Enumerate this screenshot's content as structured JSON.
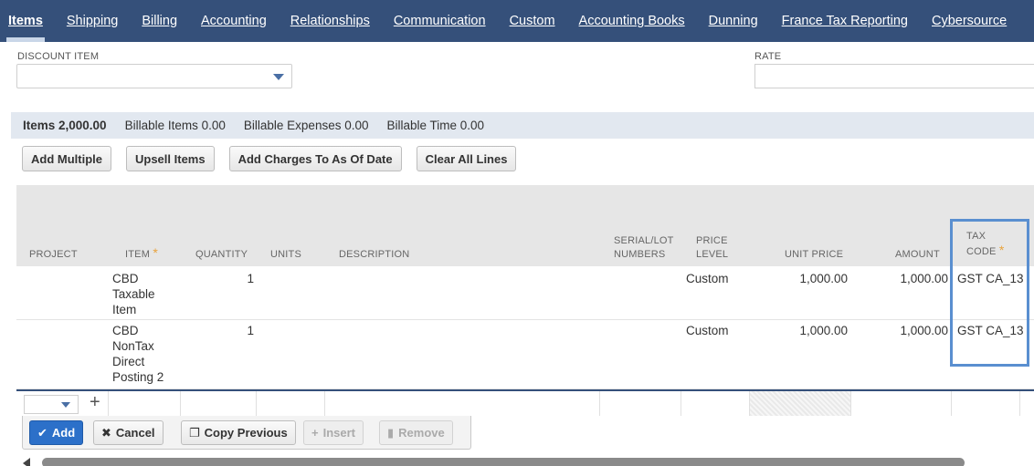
{
  "tabs": [
    {
      "label": "Items",
      "active": true
    },
    {
      "label": "Shipping"
    },
    {
      "label": "Billing"
    },
    {
      "label": "Accounting"
    },
    {
      "label": "Relationships"
    },
    {
      "label": "Communication"
    },
    {
      "label": "Custom"
    },
    {
      "label": "Accounting Books"
    },
    {
      "label": "Dunning"
    },
    {
      "label": "France Tax Reporting"
    },
    {
      "label": "Cybersource"
    }
  ],
  "fields": {
    "discount_label": "DISCOUNT ITEM",
    "discount_value": "",
    "rate_label": "RATE",
    "rate_value": ""
  },
  "subtabs": [
    {
      "label": "Items 2,000.00",
      "active": true
    },
    {
      "label": "Billable Items 0.00"
    },
    {
      "label": "Billable Expenses 0.00"
    },
    {
      "label": "Billable Time 0.00"
    }
  ],
  "buttons": {
    "add_multiple": "Add Multiple",
    "upsell": "Upsell Items",
    "add_charges": "Add Charges To As Of Date",
    "clear_all": "Clear All Lines"
  },
  "columns": {
    "project": "PROJECT",
    "item": "ITEM",
    "quantity": "QUANTITY",
    "units": "UNITS",
    "description": "DESCRIPTION",
    "serial_1": "SERIAL/LOT",
    "serial_2": "NUMBERS",
    "price_1": "PRICE",
    "price_2": "LEVEL",
    "unit_price": "UNIT PRICE",
    "amount": "AMOUNT",
    "tax_1": "TAX",
    "tax_2": "CODE",
    "required_mark": "*"
  },
  "rows": [
    {
      "item_lines": [
        "CBD",
        "Taxable",
        "Item"
      ],
      "quantity": "1",
      "price_level": "Custom",
      "unit_price": "1,000.00",
      "amount": "1,000.00",
      "tax_code": "GST CA_13"
    },
    {
      "item_lines": [
        "CBD",
        "NonTax",
        "Direct",
        "Posting 2"
      ],
      "quantity": "1",
      "price_level": "Custom",
      "unit_price": "1,000.00",
      "amount": "1,000.00",
      "tax_code": "GST CA_13"
    }
  ],
  "line_buttons": {
    "add": "Add",
    "cancel": "Cancel",
    "copy_previous": "Copy Previous",
    "insert": "Insert",
    "remove": "Remove"
  },
  "colors": {
    "tabbar": "#35507a",
    "highlight": "#5a8fd0",
    "primary_button": "#2c70c9",
    "required": "#e8a33d"
  },
  "icons": [
    "caret-down-icon",
    "plus-icon",
    "check-icon",
    "x-icon",
    "copy-icon",
    "insert-plus-icon",
    "trash-icon",
    "scroll-left-icon"
  ]
}
